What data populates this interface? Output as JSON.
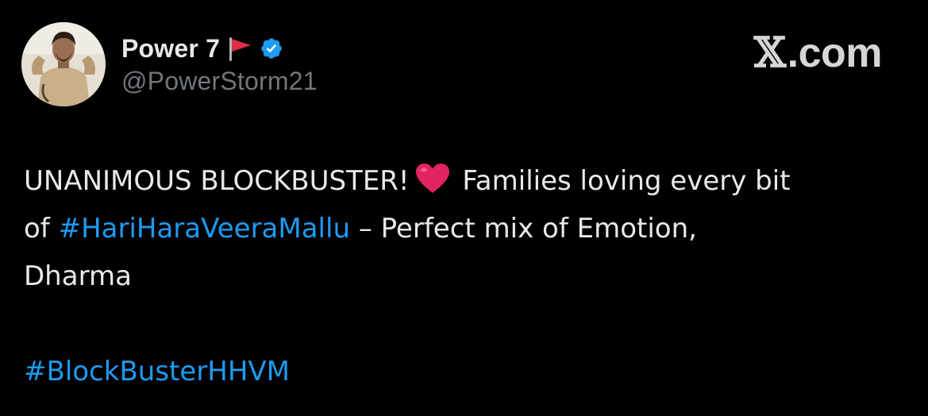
{
  "author": {
    "display_name": "Power 7",
    "handle": "@PowerStorm21",
    "flag_icon": "red-flag-icon",
    "verified_icon": "verified-badge-icon",
    "verified_color": "#1d9bf0"
  },
  "brand": {
    "x_glyph": "𝕏",
    "suffix": ".com"
  },
  "tweet": {
    "line1_text": "UNANIMOUS BLOCKBUSTER!",
    "heart_icon": "red-heart-icon",
    "line1_rest": "Families loving every bit",
    "line2_prefix": "of",
    "hashtag1": "#HariHaraVeeraMallu",
    "line2_rest": "– Perfect mix of Emotion,",
    "line3": "Dharma",
    "hashtag2": "#BlockBusterHHVM"
  },
  "colors": {
    "background": "#000000",
    "text": "#e7e9ea",
    "secondary": "#71767b",
    "link": "#1d9bf0",
    "heart": "#e0245e"
  }
}
